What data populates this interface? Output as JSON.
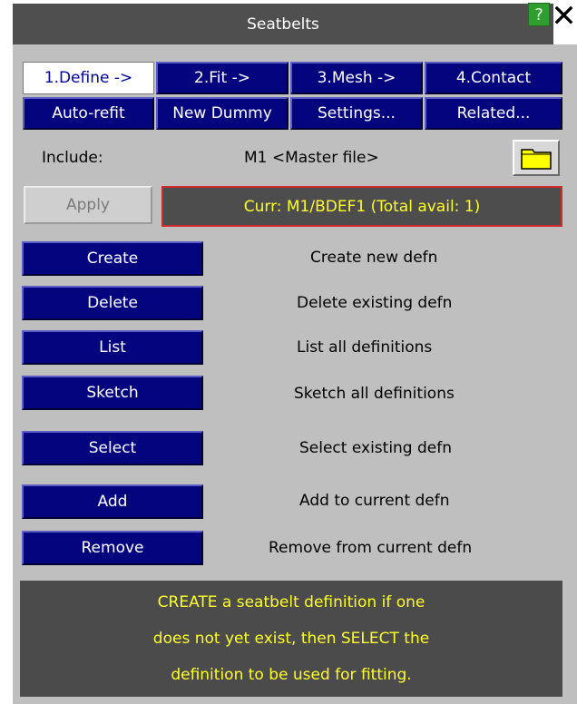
{
  "window": {
    "title": "Seatbelts",
    "help_label": "?",
    "close_label": "✕"
  },
  "tabs": [
    {
      "label": "1.Define ->",
      "active": true
    },
    {
      "label": "2.Fit ->",
      "active": false
    },
    {
      "label": "3.Mesh ->",
      "active": false
    },
    {
      "label": "4.Contact",
      "active": false
    }
  ],
  "tabs_row2": [
    {
      "label": "Auto-refit"
    },
    {
      "label": "New Dummy"
    },
    {
      "label": "Settings..."
    },
    {
      "label": "Related..."
    }
  ],
  "include": {
    "label": "Include:",
    "value": "M1  <Master file>"
  },
  "apply": {
    "label": "Apply",
    "enabled": false
  },
  "current": {
    "text": "Curr: M1/BDEF1 (Total avail: 1)"
  },
  "actions": [
    {
      "label": "Create",
      "desc": "Create new defn"
    },
    {
      "label": "Delete",
      "desc": "Delete existing defn"
    },
    {
      "label": "List",
      "desc": "List all definitions"
    },
    {
      "label": "Sketch",
      "desc": "Sketch all definitions"
    },
    {
      "label": "Select",
      "desc": "Select existing defn"
    },
    {
      "label": "Add",
      "desc": "Add to current defn"
    },
    {
      "label": "Remove",
      "desc": "Remove from current defn"
    }
  ],
  "info_lines": [
    "CREATE a seatbelt definition if one",
    "does not yet exist, then SELECT the",
    "definition to be used for fitting."
  ],
  "colors": {
    "button_blue": "#04047e",
    "title_bar": "#4f4f4f",
    "panel_bg": "#bfbfbf",
    "info_text": "#ffff2a",
    "current_border": "#d12a2a",
    "help_green": "#2f9d2f",
    "folder_yellow": "#ffff00"
  },
  "icons": {
    "help": "help-icon",
    "close": "close-icon",
    "folder": "folder-icon"
  }
}
